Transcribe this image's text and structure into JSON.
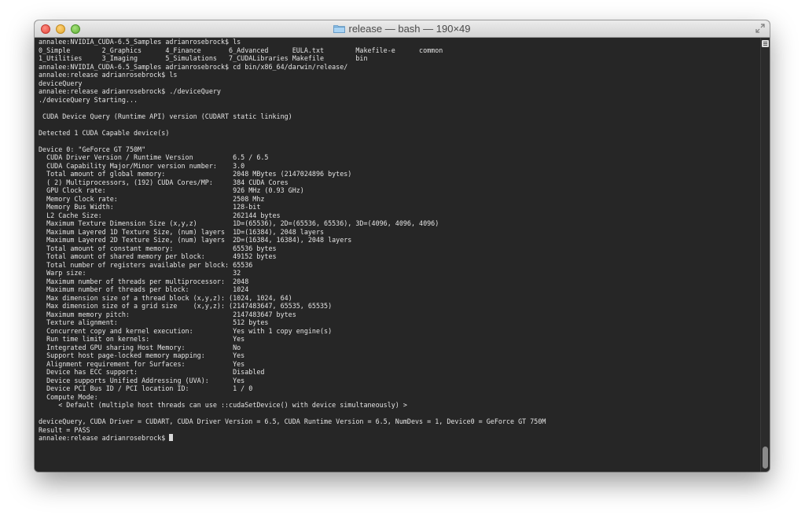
{
  "window": {
    "title": "release — bash — 190×49"
  },
  "terminal": {
    "lines": [
      "annalee:NVIDIA_CUDA-6.5_Samples adrianrosebrock$ ls",
      "0_Simple        2_Graphics      4_Finance       6_Advanced      EULA.txt        Makefile-e      common",
      "1_Utilities     3_Imaging       5_Simulations   7_CUDALibraries Makefile        bin",
      "annalee:NVIDIA_CUDA-6.5_Samples adrianrosebrock$ cd bin/x86_64/darwin/release/",
      "annalee:release adrianrosebrock$ ls",
      "deviceQuery",
      "annalee:release adrianrosebrock$ ./deviceQuery",
      "./deviceQuery Starting...",
      "",
      " CUDA Device Query (Runtime API) version (CUDART static linking)",
      "",
      "Detected 1 CUDA Capable device(s)",
      "",
      "Device 0: \"GeForce GT 750M\"",
      "  CUDA Driver Version / Runtime Version          6.5 / 6.5",
      "  CUDA Capability Major/Minor version number:    3.0",
      "  Total amount of global memory:                 2048 MBytes (2147024896 bytes)",
      "  ( 2) Multiprocessors, (192) CUDA Cores/MP:     384 CUDA Cores",
      "  GPU Clock rate:                                926 MHz (0.93 GHz)",
      "  Memory Clock rate:                             2508 Mhz",
      "  Memory Bus Width:                              128-bit",
      "  L2 Cache Size:                                 262144 bytes",
      "  Maximum Texture Dimension Size (x,y,z)         1D=(65536), 2D=(65536, 65536), 3D=(4096, 4096, 4096)",
      "  Maximum Layered 1D Texture Size, (num) layers  1D=(16384), 2048 layers",
      "  Maximum Layered 2D Texture Size, (num) layers  2D=(16384, 16384), 2048 layers",
      "  Total amount of constant memory:               65536 bytes",
      "  Total amount of shared memory per block:       49152 bytes",
      "  Total number of registers available per block: 65536",
      "  Warp size:                                     32",
      "  Maximum number of threads per multiprocessor:  2048",
      "  Maximum number of threads per block:           1024",
      "  Max dimension size of a thread block (x,y,z): (1024, 1024, 64)",
      "  Max dimension size of a grid size    (x,y,z): (2147483647, 65535, 65535)",
      "  Maximum memory pitch:                          2147483647 bytes",
      "  Texture alignment:                             512 bytes",
      "  Concurrent copy and kernel execution:          Yes with 1 copy engine(s)",
      "  Run time limit on kernels:                     Yes",
      "  Integrated GPU sharing Host Memory:            No",
      "  Support host page-locked memory mapping:       Yes",
      "  Alignment requirement for Surfaces:            Yes",
      "  Device has ECC support:                        Disabled",
      "  Device supports Unified Addressing (UVA):      Yes",
      "  Device PCI Bus ID / PCI location ID:           1 / 0",
      "  Compute Mode:",
      "     < Default (multiple host threads can use ::cudaSetDevice() with device simultaneously) >",
      "",
      "deviceQuery, CUDA Driver = CUDART, CUDA Driver Version = 6.5, CUDA Runtime Version = 6.5, NumDevs = 1, Device0 = GeForce GT 750M",
      "Result = PASS"
    ],
    "prompt": "annalee:release adrianrosebrock$ "
  }
}
